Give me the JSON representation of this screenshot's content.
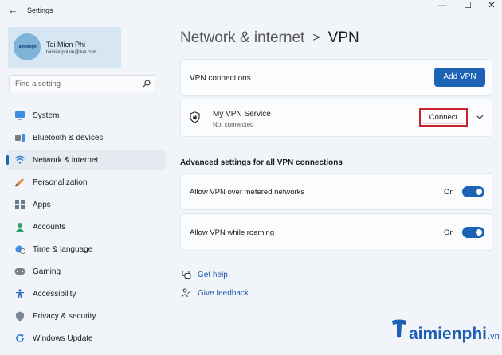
{
  "window": {
    "title": "Settings"
  },
  "user": {
    "name": "Tai Mien Phi",
    "email": "taimienphi.vn@live.com",
    "avatar_text": "Taimienphi"
  },
  "search": {
    "placeholder": "Find a setting"
  },
  "sidebar": {
    "items": [
      {
        "label": "System",
        "icon": "monitor-icon"
      },
      {
        "label": "Bluetooth & devices",
        "icon": "bluetooth-icon"
      },
      {
        "label": "Network & internet",
        "icon": "wifi-icon",
        "active": true
      },
      {
        "label": "Personalization",
        "icon": "brush-icon"
      },
      {
        "label": "Apps",
        "icon": "apps-icon"
      },
      {
        "label": "Accounts",
        "icon": "person-icon"
      },
      {
        "label": "Time & language",
        "icon": "globe-clock-icon"
      },
      {
        "label": "Gaming",
        "icon": "gamepad-icon"
      },
      {
        "label": "Accessibility",
        "icon": "accessibility-icon"
      },
      {
        "label": "Privacy & security",
        "icon": "shield-icon"
      },
      {
        "label": "Windows Update",
        "icon": "update-icon"
      }
    ]
  },
  "breadcrumb": {
    "parent": "Network & internet",
    "separator": ">",
    "current": "VPN"
  },
  "vpn_connections": {
    "label": "VPN connections",
    "add_button": "Add VPN"
  },
  "vpn_service": {
    "name": "My VPN Service",
    "status": "Not connected",
    "connect_button": "Connect"
  },
  "advanced": {
    "heading": "Advanced settings for all VPN connections",
    "metered": {
      "label": "Allow VPN over metered networks",
      "state": "On"
    },
    "roaming": {
      "label": "Allow VPN while roaming",
      "state": "On"
    }
  },
  "links": {
    "help": "Get help",
    "feedback": "Give feedback"
  },
  "watermark": {
    "brand": "aimienphi",
    "domain": ".vn"
  },
  "colors": {
    "accent": "#1c63b7",
    "highlight_border": "#c8232c",
    "background": "#f1f4f9"
  }
}
